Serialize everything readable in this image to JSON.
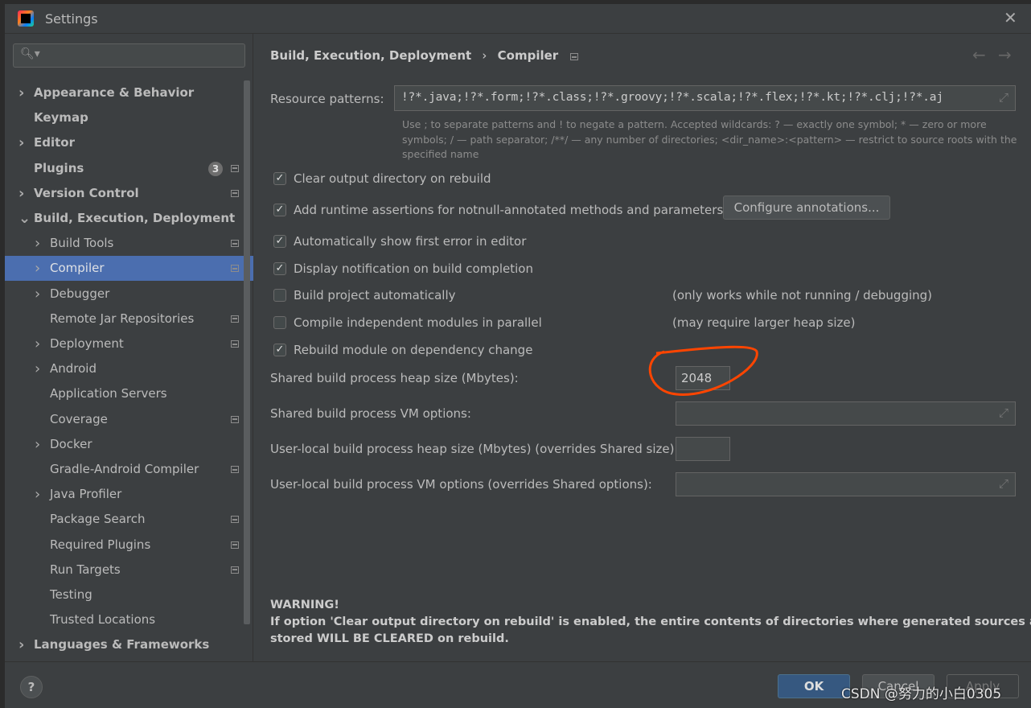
{
  "window": {
    "title": "Settings",
    "close_icon": "close-icon",
    "app_icon": "intellij-logo"
  },
  "sidebar": {
    "search_placeholder": "",
    "items": [
      {
        "label": "Appearance & Behavior",
        "level": 0,
        "expandable": true,
        "bold": true
      },
      {
        "label": "Keymap",
        "level": 0,
        "expandable": false,
        "bold": true
      },
      {
        "label": "Editor",
        "level": 0,
        "expandable": true,
        "bold": true
      },
      {
        "label": "Plugins",
        "level": 0,
        "expandable": false,
        "bold": true,
        "badge": "3",
        "project_icon": true
      },
      {
        "label": "Version Control",
        "level": 0,
        "expandable": true,
        "bold": true,
        "project_icon": true
      },
      {
        "label": "Build, Execution, Deployment",
        "level": 0,
        "expandable": true,
        "expanded": true,
        "bold": true
      },
      {
        "label": "Build Tools",
        "level": 1,
        "expandable": true,
        "project_icon": true
      },
      {
        "label": "Compiler",
        "level": 1,
        "expandable": true,
        "selected": true,
        "project_icon": true
      },
      {
        "label": "Debugger",
        "level": 1,
        "expandable": true
      },
      {
        "label": "Remote Jar Repositories",
        "level": 1,
        "expandable": false,
        "project_icon": true
      },
      {
        "label": "Deployment",
        "level": 1,
        "expandable": true,
        "project_icon": true
      },
      {
        "label": "Android",
        "level": 1,
        "expandable": true
      },
      {
        "label": "Application Servers",
        "level": 1,
        "expandable": false
      },
      {
        "label": "Coverage",
        "level": 1,
        "expandable": false,
        "project_icon": true
      },
      {
        "label": "Docker",
        "level": 1,
        "expandable": true
      },
      {
        "label": "Gradle-Android Compiler",
        "level": 1,
        "expandable": false,
        "project_icon": true
      },
      {
        "label": "Java Profiler",
        "level": 1,
        "expandable": true
      },
      {
        "label": "Package Search",
        "level": 1,
        "expandable": false,
        "project_icon": true
      },
      {
        "label": "Required Plugins",
        "level": 1,
        "expandable": false,
        "project_icon": true
      },
      {
        "label": "Run Targets",
        "level": 1,
        "expandable": false,
        "project_icon": true
      },
      {
        "label": "Testing",
        "level": 1,
        "expandable": false
      },
      {
        "label": "Trusted Locations",
        "level": 1,
        "expandable": false
      },
      {
        "label": "Languages & Frameworks",
        "level": 0,
        "expandable": true,
        "bold": true
      }
    ]
  },
  "breadcrumb": {
    "parent": "Build, Execution, Deployment",
    "separator": "›",
    "current": "Compiler"
  },
  "resource": {
    "label": "Resource patterns:",
    "value": "!?*.java;!?*.form;!?*.class;!?*.groovy;!?*.scala;!?*.flex;!?*.kt;!?*.clj;!?*.aj",
    "help1": "Use ; to separate patterns and ! to negate a pattern. Accepted wildcards: ? — exactly one symbol; * — zero or more",
    "help2": "symbols; / — path separator; /**/ — any number of directories; <dir_name>:<pattern> — restrict to source roots with the",
    "help3": "specified name"
  },
  "options": [
    {
      "label": "Clear output directory on rebuild",
      "checked": true
    },
    {
      "label": "Add runtime assertions for notnull-annotated methods and parameters",
      "checked": true
    },
    {
      "label": "Automatically show first error in editor",
      "checked": true
    },
    {
      "label": "Display notification on build completion",
      "checked": true
    },
    {
      "label": "Build project automatically",
      "checked": false,
      "note": "(only works while not running / debugging)"
    },
    {
      "label": "Compile independent modules in parallel",
      "checked": false,
      "note": "(may require larger heap size)"
    },
    {
      "label": "Rebuild module on dependency change",
      "checked": true
    }
  ],
  "configure_annotations": "Configure annotations...",
  "fields": {
    "shared_heap_label": "Shared build process heap size (Mbytes):",
    "shared_heap_value": "2048",
    "shared_vm_label": "Shared build process VM options:",
    "shared_vm_value": "",
    "local_heap_label": "User-local build process heap size (Mbytes) (overrides Shared size):",
    "local_heap_value": "",
    "local_vm_label": "User-local build process VM options (overrides Shared options):",
    "local_vm_value": ""
  },
  "warning": {
    "title": "WARNING!",
    "line1": "If option 'Clear output directory on rebuild' is enabled, the entire contents of directories where generated sources are",
    "line2": "stored WILL BE CLEARED on rebuild."
  },
  "footer": {
    "help": "?",
    "ok": "OK",
    "cancel": "Cancel",
    "apply": "Apply"
  },
  "watermark": "CSDN @努力的小白0305",
  "colors": {
    "accent": "#4b6eaf",
    "annotation": "#ff4500",
    "ok": "#365880"
  }
}
